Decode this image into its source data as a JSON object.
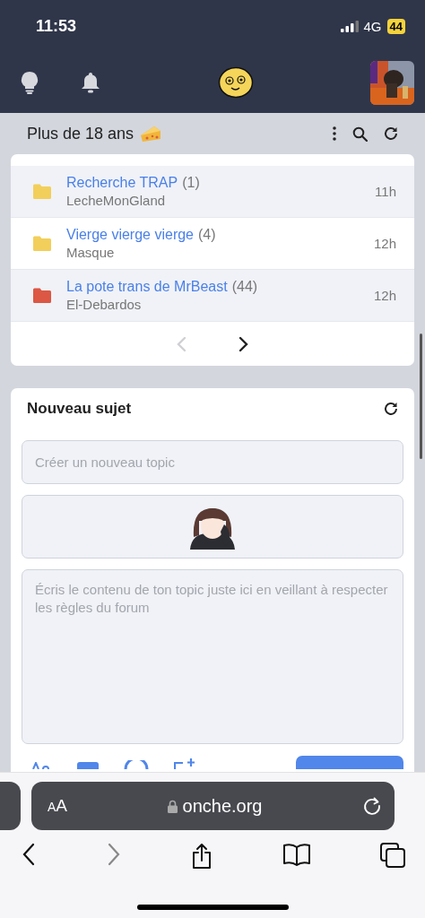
{
  "status_bar": {
    "time": "11:53",
    "network": "4G",
    "battery": "44"
  },
  "forum": {
    "title": "Plus de 18 ans"
  },
  "topics": [
    {
      "title": "Recherche TRAP",
      "count": "(1)",
      "author": "LecheMonGland",
      "time": "11h",
      "color": "#f2cf5b"
    },
    {
      "title": "Vierge vierge vierge",
      "count": "(4)",
      "author": "Masque",
      "time": "12h",
      "color": "#f2cf5b"
    },
    {
      "title": "La pote trans de MrBeast",
      "count": "(44)",
      "author": "El-Debardos",
      "time": "12h",
      "color": "#dc5744"
    }
  ],
  "pagination": {
    "prev_disabled": true,
    "next_disabled": false
  },
  "new_topic": {
    "title": "Nouveau sujet",
    "title_field": {
      "placeholder": "Créer un nouveau topic"
    },
    "message_field": {
      "placeholder": "Écris le contenu de ton topic juste ici en veillant à respecter les règles du forum"
    }
  },
  "browser": {
    "text_size": "AA",
    "url": "onche.org"
  }
}
